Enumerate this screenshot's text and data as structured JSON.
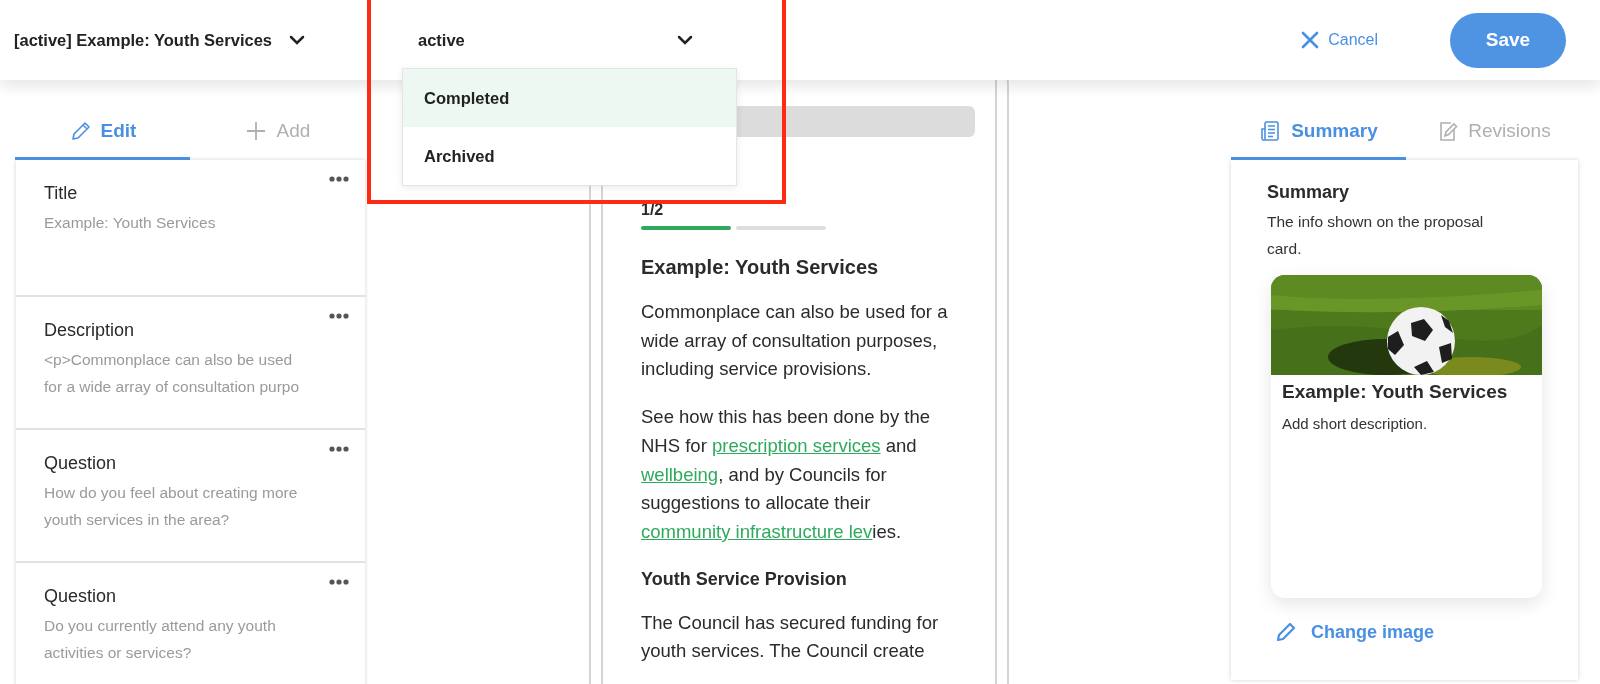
{
  "header": {
    "title": "[active] Example: Youth Services",
    "status_select": {
      "value": "active",
      "expanded": true,
      "options": [
        {
          "label": "Completed",
          "selected": true
        },
        {
          "label": "Archived",
          "selected": false
        }
      ]
    },
    "cancel": "Cancel",
    "save": "Save"
  },
  "annotation": {
    "kind": "frame"
  },
  "edit_panel": {
    "tabs": [
      {
        "kind": "edit",
        "label": "Edit",
        "selected": true
      },
      {
        "kind": "add",
        "label": "Add",
        "selected": false
      }
    ],
    "fields": [
      {
        "label": "Title",
        "value": "Example: Youth Services"
      },
      {
        "label": "Description",
        "value": "<p>Commonplace can also be used for a wide array of consultation purpo"
      },
      {
        "label": "Question",
        "value": "How do you feel about creating more youth services in the area?"
      },
      {
        "label": "Question",
        "value": "Do you currently attend any youth activities or services?"
      }
    ]
  },
  "preview": {
    "step": "1/2",
    "steps": [
      {
        "done": true
      },
      {
        "done": false
      }
    ],
    "title": "Example: Youth Services",
    "blocks": [
      {
        "kind": "paragraph",
        "segments": [
          {
            "kind": "text",
            "text": "Commonplace can also be used for a wide array of consultation purposes, including service provisions."
          }
        ]
      },
      {
        "kind": "paragraph",
        "segments": [
          {
            "kind": "text",
            "text": "See how this has been done by the NHS for "
          },
          {
            "kind": "link",
            "text": "prescription services"
          },
          {
            "kind": "text",
            "text": " and "
          },
          {
            "kind": "link",
            "text": "wellbeing"
          },
          {
            "kind": "text",
            "text": ", and by Councils for suggestions to allocate their "
          },
          {
            "kind": "link",
            "text": "community infrastructure lev"
          },
          {
            "kind": "text",
            "text": "ies."
          }
        ]
      },
      {
        "kind": "heading",
        "segments": [
          {
            "kind": "text",
            "text": "Youth Service Provision"
          }
        ]
      },
      {
        "kind": "paragraph",
        "segments": [
          {
            "kind": "text",
            "text": "The Council has secured funding for youth services. The Council create"
          }
        ]
      }
    ]
  },
  "summary_panel": {
    "tabs": [
      {
        "kind": "summary",
        "label": "Summary",
        "selected": true
      },
      {
        "kind": "revisions",
        "label": "Revisions",
        "selected": false
      }
    ],
    "heading": "Summary",
    "description": "The info shown on the proposal card.",
    "card": {
      "title": "Example: Youth Services",
      "description": "Add short description."
    },
    "change_image": "Change image"
  }
}
